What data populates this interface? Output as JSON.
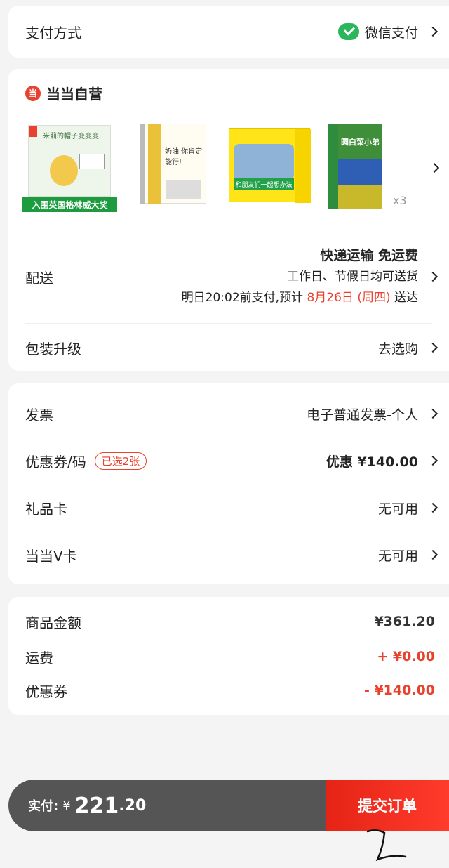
{
  "payment": {
    "label": "支付方式",
    "method": "微信支付",
    "icon": "wechat-pay-icon"
  },
  "store": {
    "name": "当当自营",
    "logo_char": "当",
    "books": [
      {
        "title": "米莉的帽子变变变",
        "banner": "入围英国格林威大奖"
      },
      {
        "title": "奶油 你肯定能行!"
      },
      {
        "title": "和朋友们一起想办法"
      },
      {
        "title": "圆白菜小弟",
        "qty": "x3"
      }
    ]
  },
  "delivery": {
    "label": "配送",
    "line1": "快递运输 免运费",
    "line2": "工作日、节假日均可送货",
    "line3_prefix": "明日20:02前支付,预计",
    "line3_date": "8月26日 (周四)",
    "line3_suffix": "送达"
  },
  "packaging": {
    "label": "包装升级",
    "value": "去选购"
  },
  "invoice": {
    "label": "发票",
    "value": "电子普通发票-个人"
  },
  "coupon": {
    "label": "优惠券/码",
    "badge": "已选2张",
    "value": "优惠 ¥140.00"
  },
  "giftcard": {
    "label": "礼品卡",
    "value": "无可用"
  },
  "vcard": {
    "label": "当当Ⅴ卡",
    "value": "无可用"
  },
  "summary": {
    "subtotal_label": "商品金额",
    "subtotal": "¥361.20",
    "shipping_label": "运费",
    "shipping": "+ ¥0.00",
    "coupon_label": "优惠券",
    "coupon": "- ¥140.00"
  },
  "pay": {
    "label": "实付:",
    "currency": "¥",
    "amount_int": "221",
    "amount_dec": ".20",
    "button": "提交订单"
  },
  "colors": {
    "accent": "#e8412d",
    "wechat": "#2ab75b",
    "bar": "#555555"
  }
}
